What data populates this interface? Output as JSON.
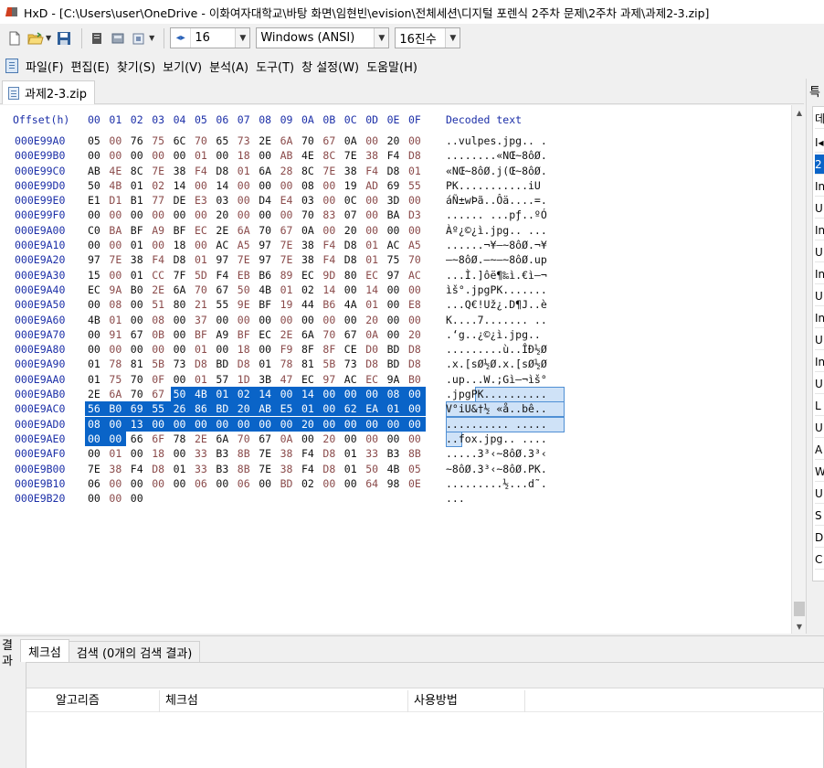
{
  "window": {
    "title": "HxD - [C:\\Users\\user\\OneDrive - 이화여자대학교\\바탕 화면\\임현빈\\evision\\전체세션\\디지털 포렌식 2주차 문제\\2주차 과제\\과제2-3.zip]"
  },
  "toolbar": {
    "bytes_per_row": "16",
    "charset": "Windows (ANSI)",
    "offset_base": "16진수"
  },
  "menu": [
    "파일(F)",
    "편집(E)",
    "찾기(S)",
    "보기(V)",
    "분석(A)",
    "도구(T)",
    "창 설정(W)",
    "도움말(H)"
  ],
  "document_tab": "과제2-3.zip",
  "hex": {
    "offset_header": "Offset(h)",
    "columns": [
      "00",
      "01",
      "02",
      "03",
      "04",
      "05",
      "06",
      "07",
      "08",
      "09",
      "0A",
      "0B",
      "0C",
      "0D",
      "0E",
      "0F"
    ],
    "decoded_header": "Decoded text",
    "rows": [
      {
        "off": "000E99A0",
        "bytes": [
          "05",
          "00",
          "76",
          "75",
          "6C",
          "70",
          "65",
          "73",
          "2E",
          "6A",
          "70",
          "67",
          "0A",
          "00",
          "20",
          "00"
        ],
        "text": "..vulpes.jpg.. ."
      },
      {
        "off": "000E99B0",
        "bytes": [
          "00",
          "00",
          "00",
          "00",
          "00",
          "01",
          "00",
          "18",
          "00",
          "AB",
          "4E",
          "8C",
          "7E",
          "38",
          "F4",
          "D8",
          "01"
        ],
        "text": "........«NŒ~8ôØ."
      },
      {
        "off": "000E99C0",
        "bytes": [
          "AB",
          "4E",
          "8C",
          "7E",
          "38",
          "F4",
          "D8",
          "01",
          "6A",
          "28",
          "8C",
          "7E",
          "38",
          "F4",
          "D8",
          "01"
        ],
        "text": "«NŒ~8ôØ.j(Œ~8ôØ."
      },
      {
        "off": "000E99D0",
        "bytes": [
          "50",
          "4B",
          "01",
          "02",
          "14",
          "00",
          "14",
          "00",
          "00",
          "00",
          "08",
          "00",
          "19",
          "AD",
          "69",
          "55"
        ],
        "text": "PK...........iU"
      },
      {
        "off": "000E99E0",
        "bytes": [
          "E1",
          "D1",
          "B1",
          "77",
          "DE",
          "E3",
          "03",
          "00",
          "D4",
          "E4",
          "03",
          "00",
          "0C",
          "00",
          "3D",
          "00"
        ],
        "text": "áÑ±wÞã..Ôä....=."
      },
      {
        "off": "000E99F0",
        "bytes": [
          "00",
          "00",
          "00",
          "00",
          "00",
          "00",
          "20",
          "00",
          "00",
          "00",
          "70",
          "83",
          "07",
          "00",
          "BA",
          "D3"
        ],
        "text": "...... ...pƒ..ºÓ"
      },
      {
        "off": "000E9A00",
        "bytes": [
          "C0",
          "BA",
          "BF",
          "A9",
          "BF",
          "EC",
          "2E",
          "6A",
          "70",
          "67",
          "0A",
          "00",
          "20",
          "00",
          "00",
          "00"
        ],
        "text": "Àº¿©¿ì.jpg.. ..."
      },
      {
        "off": "000E9A10",
        "bytes": [
          "00",
          "00",
          "01",
          "00",
          "18",
          "00",
          "AC",
          "A5",
          "97",
          "7E",
          "38",
          "F4",
          "D8",
          "01",
          "AC",
          "A5"
        ],
        "text": "......¬¥—~8ôØ.¬¥"
      },
      {
        "off": "000E9A20",
        "bytes": [
          "97",
          "7E",
          "38",
          "F4",
          "D8",
          "01",
          "97",
          "7E",
          "97",
          "7E",
          "38",
          "F4",
          "D8",
          "01",
          "75",
          "70"
        ],
        "text": "—~8ôØ.—~—~8ôØ.up"
      },
      {
        "off": "000E9A30",
        "bytes": [
          "15",
          "00",
          "01",
          "CC",
          "7F",
          "5D",
          "F4",
          "EB",
          "B6",
          "89",
          "EC",
          "9D",
          "80",
          "EC",
          "97",
          "AC"
        ],
        "text": "...Ì.]ôë¶‰ì.€ì—¬"
      },
      {
        "off": "000E9A40",
        "bytes": [
          "EC",
          "9A",
          "B0",
          "2E",
          "6A",
          "70",
          "67",
          "50",
          "4B",
          "01",
          "02",
          "14",
          "00",
          "14",
          "00",
          "00"
        ],
        "text": "ìš°.jpgPK......."
      },
      {
        "off": "000E9A50",
        "bytes": [
          "00",
          "08",
          "00",
          "51",
          "80",
          "21",
          "55",
          "9E",
          "BF",
          "19",
          "44",
          "B6",
          "4A",
          "01",
          "00",
          "E8"
        ],
        "text": "...Q€!Už¿.D¶J..è"
      },
      {
        "off": "000E9A60",
        "bytes": [
          "4B",
          "01",
          "00",
          "08",
          "00",
          "37",
          "00",
          "00",
          "00",
          "00",
          "00",
          "00",
          "00",
          "20",
          "00",
          "00"
        ],
        "text": "K....7....... .."
      },
      {
        "off": "000E9A70",
        "bytes": [
          "00",
          "91",
          "67",
          "0B",
          "00",
          "BF",
          "A9",
          "BF",
          "EC",
          "2E",
          "6A",
          "70",
          "67",
          "0A",
          "00",
          "20"
        ],
        "text": ".‘g..¿©¿ì.jpg.. "
      },
      {
        "off": "000E9A80",
        "bytes": [
          "00",
          "00",
          "00",
          "00",
          "00",
          "01",
          "00",
          "18",
          "00",
          "F9",
          "8F",
          "8F",
          "CE",
          "D0",
          "BD",
          "D8"
        ],
        "text": ".........ù..ÎÐ½Ø"
      },
      {
        "off": "000E9A90",
        "bytes": [
          "01",
          "78",
          "81",
          "5B",
          "73",
          "D8",
          "BD",
          "D8",
          "01",
          "78",
          "81",
          "5B",
          "73",
          "D8",
          "BD",
          "D8"
        ],
        "text": ".x.[sØ½Ø.x.[sØ½Ø"
      },
      {
        "off": "000E9AA0",
        "bytes": [
          "01",
          "75",
          "70",
          "0F",
          "00",
          "01",
          "57",
          "1D",
          "3B",
          "47",
          "EC",
          "97",
          "AC",
          "EC",
          "9A",
          "B0"
        ],
        "text": ".up...W.;Gì—¬ìš°"
      },
      {
        "off": "000E9AB0",
        "bytes": [
          "2E",
          "6A",
          "70",
          "67",
          "50",
          "4B",
          "01",
          "02",
          "14",
          "00",
          "14",
          "00",
          "00",
          "00",
          "08",
          "00"
        ],
        "text": ".jpgPK.........."
      },
      {
        "off": "000E9AC0",
        "bytes": [
          "56",
          "B0",
          "69",
          "55",
          "26",
          "86",
          "BD",
          "20",
          "AB",
          "E5",
          "01",
          "00",
          "62",
          "EA",
          "01",
          "00"
        ],
        "text": "V°iU&†½ «å..bê.."
      },
      {
        "off": "000E9AD0",
        "bytes": [
          "08",
          "00",
          "13",
          "00",
          "00",
          "00",
          "00",
          "00",
          "00",
          "00",
          "20",
          "00",
          "00",
          "00",
          "00",
          "00"
        ],
        "text": ".......... ....."
      },
      {
        "off": "000E9AE0",
        "bytes": [
          "00",
          "00",
          "66",
          "6F",
          "78",
          "2E",
          "6A",
          "70",
          "67",
          "0A",
          "00",
          "20",
          "00",
          "00",
          "00",
          "00"
        ],
        "text": "..fox.jpg.. ...."
      },
      {
        "off": "000E9AF0",
        "bytes": [
          "00",
          "01",
          "00",
          "18",
          "00",
          "33",
          "B3",
          "8B",
          "7E",
          "38",
          "F4",
          "D8",
          "01",
          "33",
          "B3",
          "8B"
        ],
        "text": ".....3³‹~8ôØ.3³‹"
      },
      {
        "off": "000E9B00",
        "bytes": [
          "7E",
          "38",
          "F4",
          "D8",
          "01",
          "33",
          "B3",
          "8B",
          "7E",
          "38",
          "F4",
          "D8",
          "01",
          "50",
          "4B",
          "05"
        ],
        "text": "~8ôØ.3³‹~8ôØ.PK."
      },
      {
        "off": "000E9B10",
        "bytes": [
          "06",
          "00",
          "00",
          "00",
          "00",
          "06",
          "00",
          "06",
          "00",
          "BD",
          "02",
          "00",
          "00",
          "64",
          "98",
          "0E"
        ],
        "text": ".........½...d˜."
      },
      {
        "off": "000E9B20",
        "bytes": [
          "00",
          "00",
          "00"
        ],
        "text": "..."
      }
    ]
  },
  "right_panel": {
    "tab_label": "특",
    "header_char": "데",
    "items": [
      "I◂",
      "2",
      "In",
      "U",
      "In",
      "U",
      "In",
      "U",
      "In",
      "U",
      "In",
      "U",
      "L",
      "U",
      "A",
      "W",
      "U",
      "S",
      "D",
      "C"
    ]
  },
  "bottom": {
    "vertical_label": "결과",
    "tabs": [
      "체크섬",
      "검색 (0개의 검색 결과)"
    ],
    "columns": [
      "알고리즘",
      "체크섬",
      "사용방법"
    ]
  }
}
